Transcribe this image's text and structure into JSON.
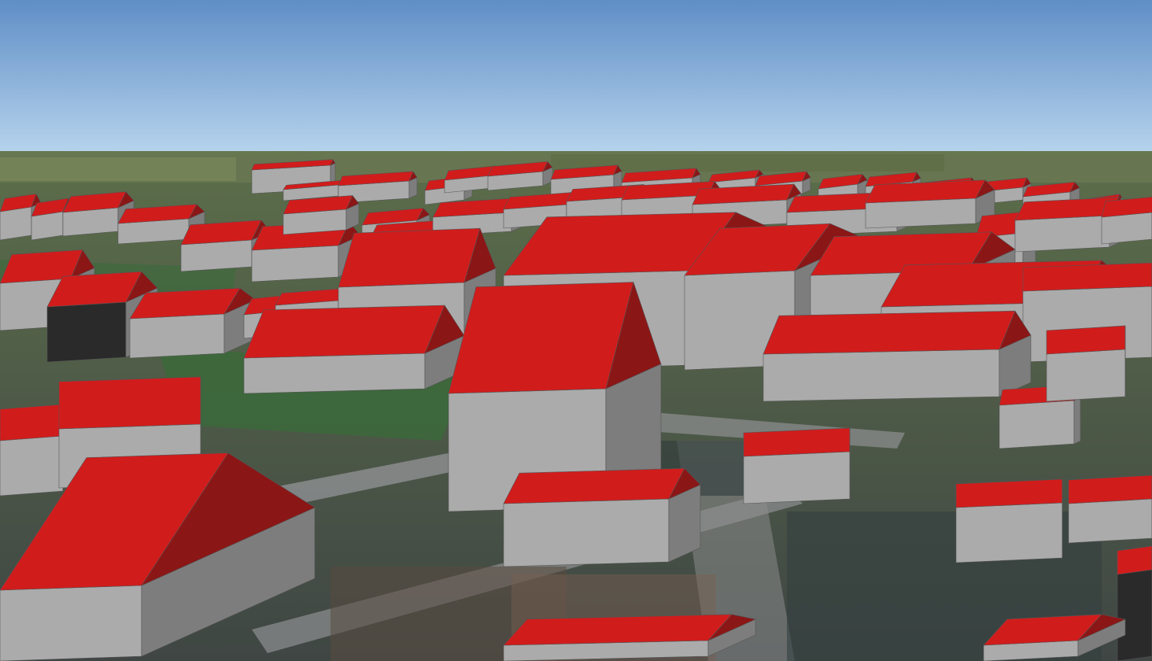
{
  "view": {
    "kind": "3d-city-model",
    "caption": "",
    "colors": {
      "sky_top": "#5f8ec6",
      "sky_horizon": "#b6d3ec",
      "roof_lit": "#d11c1c",
      "roof_shade": "#8b1616",
      "wall_lit": "#ababab",
      "wall_shade": "#7d7d7d",
      "wall_dark": "#2a2a2a",
      "ground_far": "#5c6e4a",
      "ground_near": "#3f4644",
      "road": "#8f9092",
      "grass": "#3a6a3a"
    }
  }
}
